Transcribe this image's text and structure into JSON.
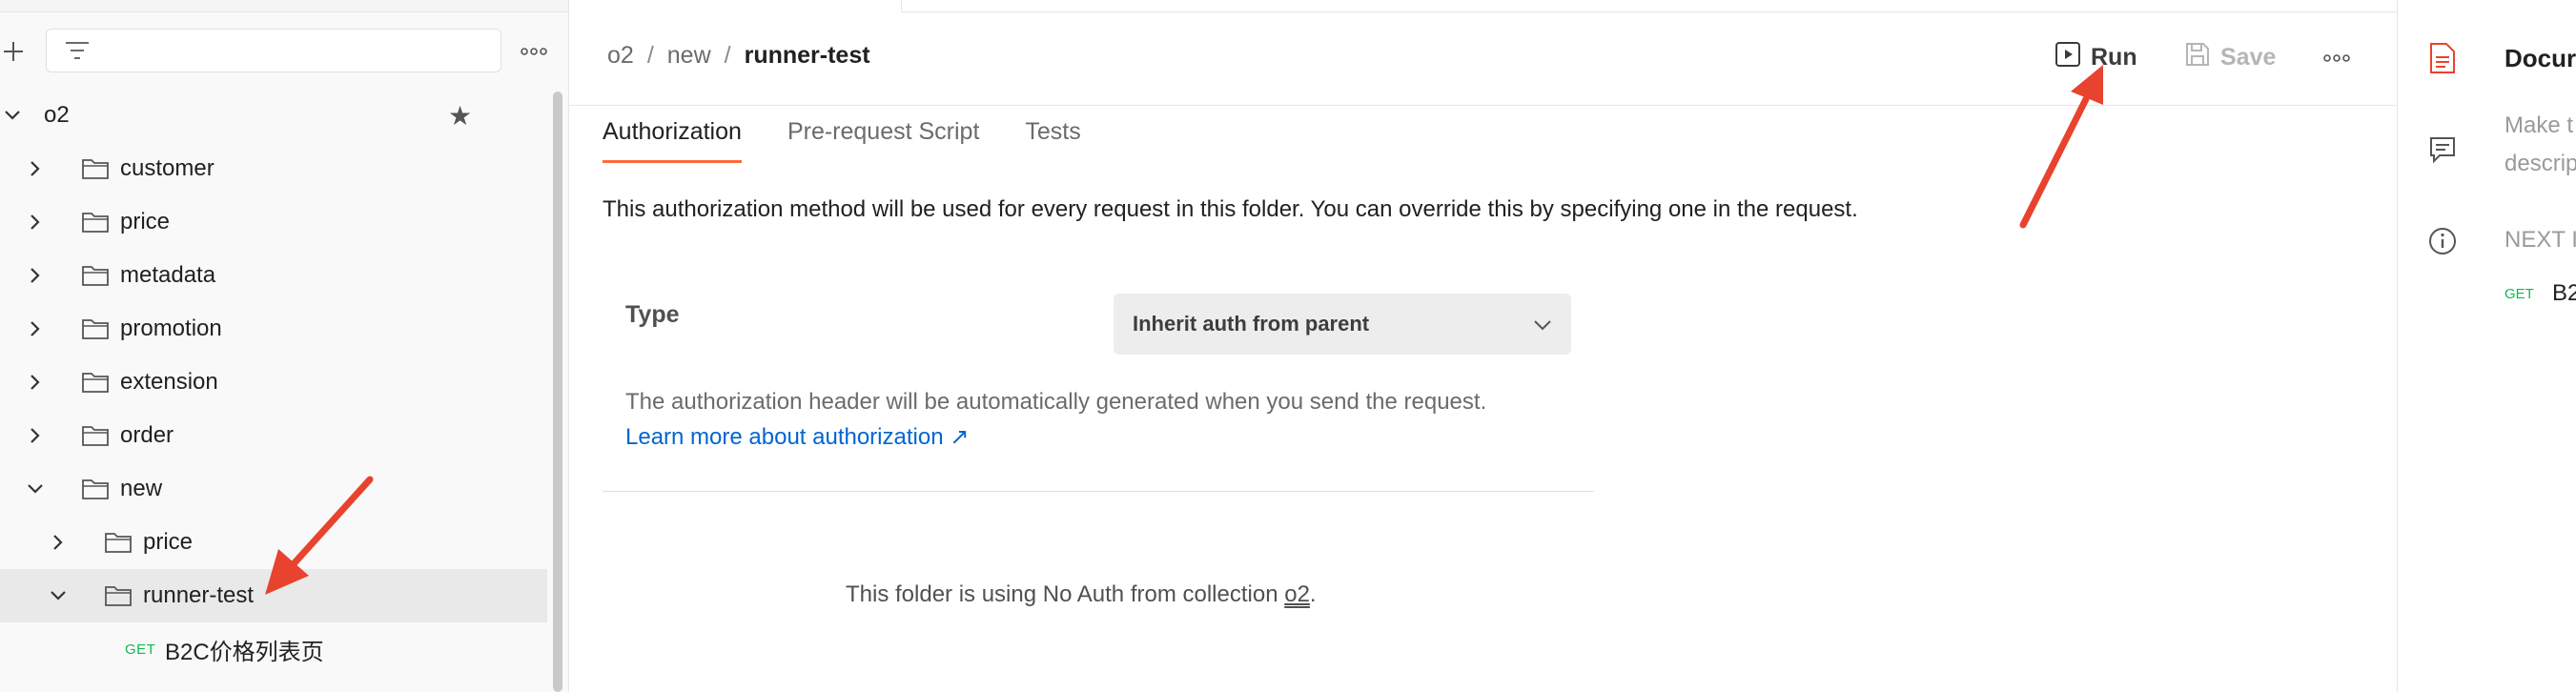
{
  "sidebar": {
    "tree": [
      {
        "label": "o2",
        "level": 0,
        "expanded": true,
        "kind": "collection",
        "starred": true
      },
      {
        "label": "customer",
        "level": 1,
        "expanded": false,
        "kind": "folder"
      },
      {
        "label": "price",
        "level": 1,
        "expanded": false,
        "kind": "folder"
      },
      {
        "label": "metadata",
        "level": 1,
        "expanded": false,
        "kind": "folder"
      },
      {
        "label": "promotion",
        "level": 1,
        "expanded": false,
        "kind": "folder"
      },
      {
        "label": "extension",
        "level": 1,
        "expanded": false,
        "kind": "folder"
      },
      {
        "label": "order",
        "level": 1,
        "expanded": false,
        "kind": "folder"
      },
      {
        "label": "new",
        "level": 1,
        "expanded": true,
        "kind": "folder"
      },
      {
        "label": "price",
        "level": 2,
        "expanded": false,
        "kind": "folder"
      },
      {
        "label": "runner-test",
        "level": 2,
        "expanded": true,
        "kind": "folder",
        "selected": true
      },
      {
        "label": "B2C价格列表页",
        "level": 3,
        "kind": "request",
        "method": "GET"
      }
    ]
  },
  "breadcrumb": {
    "items": [
      "o2",
      "new"
    ],
    "separator": "/",
    "current": "runner-test"
  },
  "toolbar": {
    "run_label": "Run",
    "save_label": "Save"
  },
  "tabs": [
    {
      "label": "Authorization",
      "active": true
    },
    {
      "label": "Pre-request Script",
      "active": false
    },
    {
      "label": "Tests",
      "active": false
    }
  ],
  "authorization": {
    "description": "This authorization method will be used for every request in this folder. You can override this by specifying one in the request.",
    "type_label": "Type",
    "type_value": "Inherit auth from parent",
    "info": "The authorization header will be automatically generated when you send the request.",
    "learn_more": "Learn more about authorization ↗",
    "note_prefix": "This folder is using No Auth from collection ",
    "note_link": "o2",
    "note_suffix": "."
  },
  "right_panel": {
    "doc_title": "Docur",
    "doc_desc_line1": "Make t",
    "doc_desc_line2": "descrip",
    "next_label": "NEXT I",
    "next_method": "GET",
    "next_item": "B2"
  },
  "colors": {
    "accent": "#ff6c37",
    "link": "#0265d2",
    "get_method": "#0cbb52",
    "arrow": "#e8432e"
  }
}
